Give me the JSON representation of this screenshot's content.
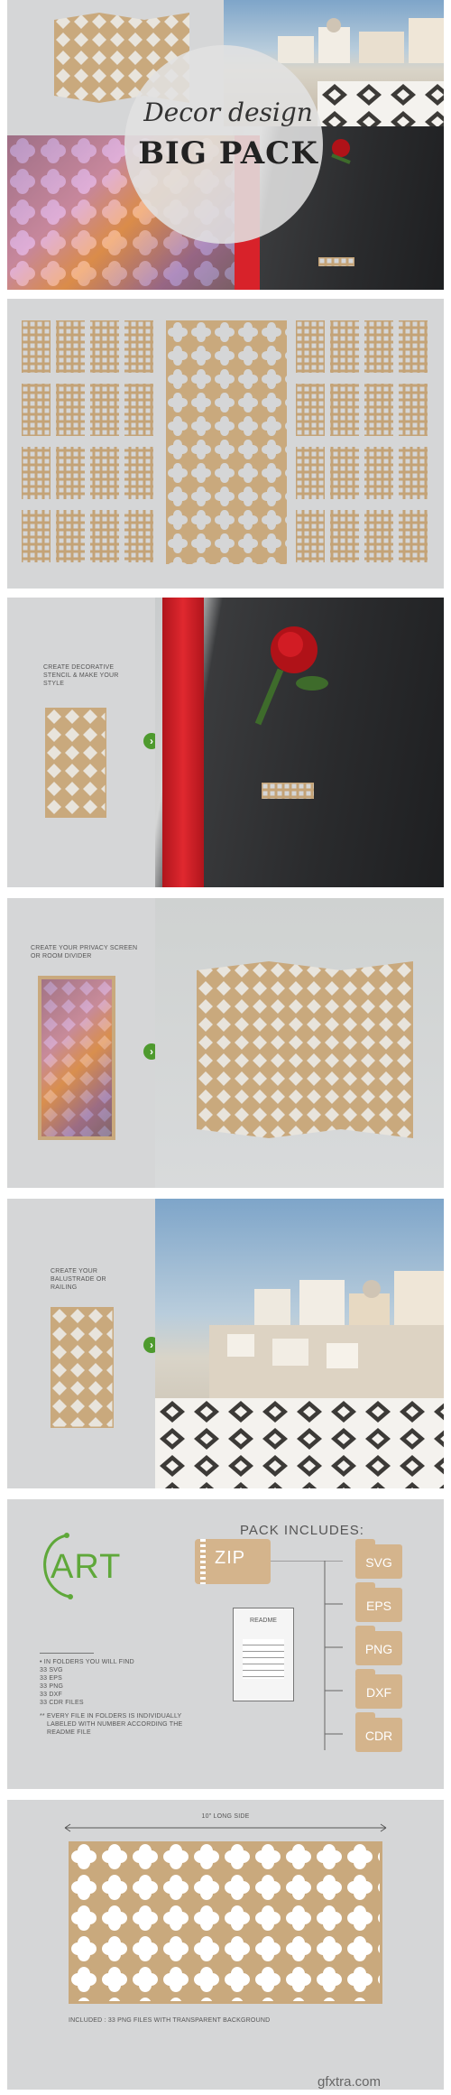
{
  "colors": {
    "gold": "#c9a97d",
    "panel_bg": "#d5d6d7",
    "arrow_green": "#4e9a2e",
    "art_green": "#5fa83a",
    "tie_red": "#d8222a"
  },
  "panel1": {
    "title_script": "Decor design",
    "title_bold": "BIG PACK"
  },
  "panel3": {
    "caption_line1": "CREATE DECORATIVE",
    "caption_line2": "STENCIL & MAKE YOUR",
    "caption_line3": "STYLE"
  },
  "panel4": {
    "caption_line1": "CREATE YOUR PRIVACY SCREEN",
    "caption_line2": "OR ROOM DIVIDER"
  },
  "panel5": {
    "caption_line1": "CREATE YOUR",
    "caption_line2": "BALUSTRADE OR",
    "caption_line3": "RAILING"
  },
  "panel6": {
    "logo": "ART",
    "pack_title": "PACK INCLUDES:",
    "zip_label": "ZIP",
    "readme_label": "README",
    "formats": [
      "SVG",
      "EPS",
      "PNG",
      "DXF",
      "CDR"
    ],
    "folder_note": "IN FOLDERS YOU WILL FIND",
    "counts": [
      "33 SVG",
      "33 EPS",
      "33 PNG",
      "33 DXF",
      "33 CDR FILES"
    ],
    "note_line1": "EVERY FILE IN FOLDERS IS INDIVIDUALLY",
    "note_line2": "LABELED WITH NUMBER ACCORDING THE",
    "note_line3": "README FILE"
  },
  "panel7": {
    "dimension_label": "10\" LONG SIDE",
    "footer": "INCLUDED : 33 PNG FILES WITH TRANSPARENT BACKGROUND"
  },
  "watermark": "gfxtra.com"
}
